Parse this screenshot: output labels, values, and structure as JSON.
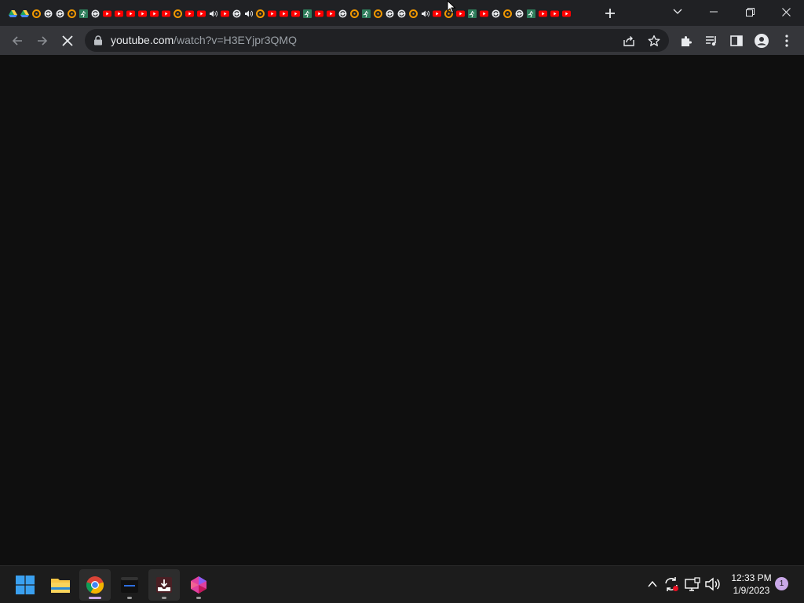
{
  "browser": {
    "tabs": [
      {
        "favicon": "drive"
      },
      {
        "favicon": "drive"
      },
      {
        "favicon": "ring"
      },
      {
        "favicon": "sync"
      },
      {
        "favicon": "sync"
      },
      {
        "favicon": "ring"
      },
      {
        "favicon": "runner"
      },
      {
        "favicon": "sync"
      },
      {
        "favicon": "youtube"
      },
      {
        "favicon": "youtube"
      },
      {
        "favicon": "youtube"
      },
      {
        "favicon": "youtube"
      },
      {
        "favicon": "youtube"
      },
      {
        "favicon": "youtube"
      },
      {
        "favicon": "ring"
      },
      {
        "favicon": "youtube"
      },
      {
        "favicon": "youtube"
      },
      {
        "favicon": "speaker"
      },
      {
        "favicon": "youtube"
      },
      {
        "favicon": "sync"
      },
      {
        "favicon": "speaker"
      },
      {
        "favicon": "ring"
      },
      {
        "favicon": "youtube"
      },
      {
        "favicon": "youtube"
      },
      {
        "favicon": "youtube"
      },
      {
        "favicon": "runner"
      },
      {
        "favicon": "youtube"
      },
      {
        "favicon": "youtube"
      },
      {
        "favicon": "sync"
      },
      {
        "favicon": "ring"
      },
      {
        "favicon": "runner"
      },
      {
        "favicon": "ring"
      },
      {
        "favicon": "sync"
      },
      {
        "favicon": "sync"
      },
      {
        "favicon": "ring"
      },
      {
        "favicon": "speaker"
      },
      {
        "favicon": "youtube"
      },
      {
        "favicon": "ring"
      },
      {
        "favicon": "youtube"
      },
      {
        "favicon": "runner"
      },
      {
        "favicon": "youtube"
      },
      {
        "favicon": "sync"
      },
      {
        "favicon": "ring"
      },
      {
        "favicon": "sync"
      },
      {
        "favicon": "runner"
      },
      {
        "favicon": "youtube"
      },
      {
        "favicon": "youtube"
      },
      {
        "favicon": "youtube"
      }
    ],
    "url_domain": "youtube.com",
    "url_path": "/watch?v=H3EYjpr3QMQ",
    "page_loading": true
  },
  "taskbar": {
    "apps": [
      {
        "name": "start",
        "icon": "windows-logo-icon"
      },
      {
        "name": "file-explorer",
        "icon": "folder-icon"
      },
      {
        "name": "chrome",
        "icon": "chrome-icon",
        "active": true
      },
      {
        "name": "terminal",
        "icon": "terminal-icon"
      },
      {
        "name": "download-app",
        "icon": "download-tray-icon"
      },
      {
        "name": "gem-app",
        "icon": "gem-icon"
      }
    ],
    "clock": {
      "time": "12:33 PM",
      "date": "1/9/2023"
    },
    "notification_count": "1"
  },
  "colors": {
    "tab_strip": "#202124",
    "toolbar": "#35363a",
    "page_background": "#0f0f0f",
    "taskbar": "#1c1c1c",
    "youtube_red": "#ff0000",
    "ring_orange": "#f29900",
    "active_indicator": "#c9a8e8"
  }
}
